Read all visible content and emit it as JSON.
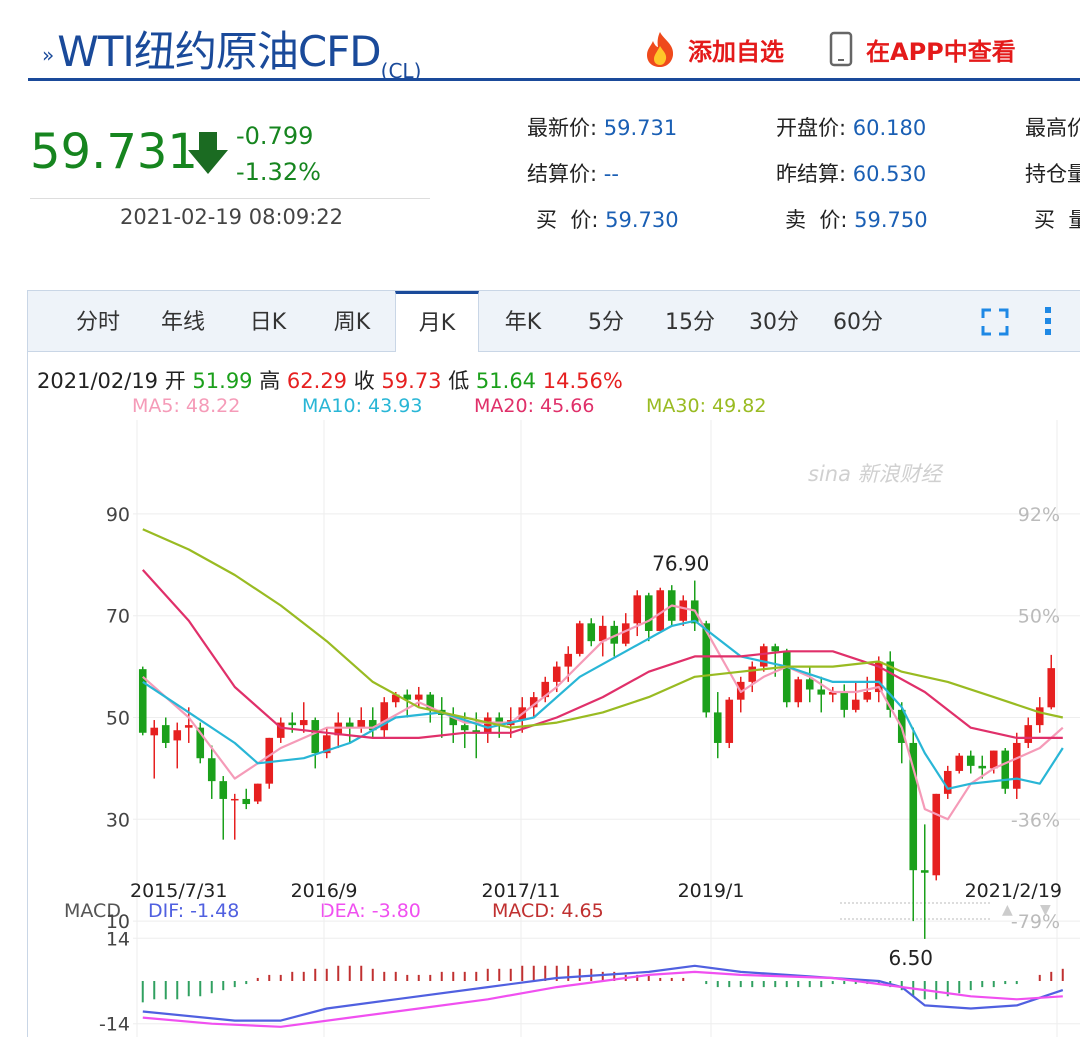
{
  "header": {
    "title": "WTI纽约原油CFD",
    "code": "(CL)",
    "add_favorite": "添加自选",
    "view_app": "在APP中查看"
  },
  "quote": {
    "price": "59.731",
    "change": "-0.799",
    "change_pct": "-1.32%",
    "time": "2021-02-19 08:09:22",
    "latest_label": "最新价:",
    "latest": "59.731",
    "open_label": "开盘价:",
    "open": "60.180",
    "high_label": "最高价",
    "settle_label": "结算价:",
    "settle": "--",
    "prev_settle_label": "昨结算:",
    "prev_settle": "60.530",
    "oi_label": "持仓量",
    "bid_label": "买  价:",
    "bid": "59.730",
    "ask_label": "卖  价:",
    "ask": "59.750",
    "bid_vol_label": "买  量"
  },
  "tabs": [
    "分时",
    "年线",
    "日K",
    "周K",
    "月K",
    "年K",
    "5分",
    "15分",
    "30分",
    "60分"
  ],
  "active_tab": "月K",
  "info": {
    "date": "2021/02/19",
    "open_label": "开",
    "open": "51.99",
    "high_label": "高",
    "high": "62.29",
    "close_label": "收",
    "close": "59.73",
    "low_label": "低",
    "low": "51.64",
    "pct": "14.56%",
    "ma5": "MA5: 48.22",
    "ma10": "MA10: 43.93",
    "ma20": "MA20: 45.66",
    "ma30": "MA30: 49.82"
  },
  "macd_info": {
    "label": "MACD",
    "dif": "DIF: -1.48",
    "dea": "DEA: -3.80",
    "macd": "MACD: 4.65"
  },
  "watermark": "sina 新浪财经",
  "colors": {
    "up": "#e62020",
    "down": "#1ba01b",
    "ma5": "#f59bb8",
    "ma10": "#29b6d6",
    "ma20": "#e0306a",
    "ma30": "#99bb22",
    "dif": "#5060e0",
    "dea": "#f050f0"
  },
  "chart_data": [
    {
      "type": "candlestick",
      "title": "",
      "ylim": [
        2,
        96
      ],
      "y_ticks": [
        90,
        70,
        50,
        30,
        10
      ],
      "pct_ticks": [
        "92%",
        "50%",
        "-36%",
        "-79%"
      ],
      "x_labels": [
        "2015/7/31",
        "2016/9",
        "2017/11",
        "2019/1",
        "2021/2/19"
      ],
      "annotations": [
        {
          "text": "76.90",
          "at": "high"
        },
        {
          "text": "6.50",
          "at": "low"
        }
      ],
      "candles": [
        [
          59.5,
          47,
          60,
          46.5
        ],
        [
          46.5,
          48,
          49.5,
          38
        ],
        [
          48.5,
          45,
          50,
          44
        ],
        [
          45.5,
          47.5,
          49,
          40
        ],
        [
          48,
          48.5,
          52,
          45
        ],
        [
          48,
          42,
          49,
          41
        ],
        [
          42,
          37.5,
          44.5,
          34
        ],
        [
          37.5,
          34,
          38.5,
          26
        ],
        [
          34,
          34,
          35,
          26
        ],
        [
          34,
          33,
          36,
          32
        ],
        [
          33.5,
          37,
          37,
          33
        ],
        [
          37,
          46,
          46,
          36
        ],
        [
          46,
          49,
          50,
          45
        ],
        [
          49,
          48.5,
          51,
          47
        ],
        [
          48.5,
          49.5,
          53,
          47
        ],
        [
          49.5,
          43,
          50,
          40
        ],
        [
          43,
          46.5,
          48,
          42
        ],
        [
          46.5,
          49,
          51,
          44
        ],
        [
          49,
          48,
          50,
          45
        ],
        [
          48,
          49.5,
          52,
          47
        ],
        [
          49.5,
          47.5,
          52,
          46
        ],
        [
          47.5,
          53,
          54,
          46
        ],
        [
          53,
          54.5,
          55,
          52
        ],
        [
          54.5,
          53.5,
          55.5,
          50
        ],
        [
          53.5,
          54.5,
          56,
          52
        ],
        [
          54.5,
          51.5,
          55,
          49
        ],
        [
          51.5,
          50.5,
          54,
          46
        ],
        [
          50.5,
          48.5,
          52,
          45
        ],
        [
          48.5,
          47.5,
          51,
          44
        ],
        [
          47.5,
          47,
          51,
          42
        ],
        [
          47,
          50,
          51,
          45
        ],
        [
          50,
          48.5,
          51,
          46
        ],
        [
          48.5,
          49.5,
          52,
          46
        ],
        [
          49.5,
          52,
          54,
          47
        ],
        [
          52,
          54,
          55,
          50
        ],
        [
          54,
          57,
          58,
          53
        ],
        [
          57,
          60,
          61,
          55
        ],
        [
          60,
          62.5,
          64,
          57
        ],
        [
          62.5,
          68.5,
          69,
          62
        ],
        [
          68.5,
          65,
          69.5,
          64
        ],
        [
          65,
          68,
          70,
          62
        ],
        [
          68,
          64.5,
          69,
          62
        ],
        [
          64.5,
          68.5,
          70.5,
          64
        ],
        [
          68.5,
          74,
          75,
          66
        ],
        [
          74,
          67,
          74.5,
          65
        ],
        [
          67,
          75,
          75.5,
          67
        ],
        [
          75,
          69,
          76,
          68
        ],
        [
          69,
          73,
          74,
          68
        ],
        [
          73,
          68.5,
          76.9,
          67
        ],
        [
          68.5,
          51,
          69,
          50
        ],
        [
          51,
          45,
          55,
          42
        ],
        [
          45,
          53.5,
          54,
          44
        ],
        [
          53.5,
          57,
          58,
          51
        ],
        [
          57,
          60,
          61,
          55
        ],
        [
          60,
          64,
          64.5,
          59
        ],
        [
          64,
          63,
          64.5,
          58
        ],
        [
          63,
          53,
          63.5,
          52
        ],
        [
          53,
          57.5,
          58,
          52
        ],
        [
          57.5,
          55.5,
          60,
          53
        ],
        [
          55.5,
          54.5,
          58,
          51
        ],
        [
          54.5,
          55,
          56,
          53
        ],
        [
          55,
          51.5,
          56.5,
          50
        ],
        [
          51.5,
          53.5,
          57,
          51
        ],
        [
          53.5,
          55,
          58,
          53
        ],
        [
          55,
          61,
          62,
          53
        ],
        [
          61,
          51.5,
          63,
          50
        ],
        [
          51.5,
          45,
          53,
          41
        ],
        [
          45,
          20,
          48,
          10
        ],
        [
          20,
          19.5,
          29,
          6.5
        ],
        [
          19,
          35,
          35,
          18
        ],
        [
          35,
          39.5,
          40.5,
          34
        ],
        [
          39.5,
          42.5,
          43,
          39
        ],
        [
          42.5,
          40.5,
          43.5,
          39
        ],
        [
          40.5,
          40,
          42.5,
          38
        ],
        [
          40,
          43.5,
          43.5,
          39
        ],
        [
          43.5,
          36,
          44,
          35
        ],
        [
          36,
          45,
          47,
          34
        ],
        [
          45,
          48.5,
          50,
          44
        ],
        [
          48.5,
          52,
          54,
          47
        ],
        [
          52,
          59.7,
          62.3,
          51.6
        ]
      ],
      "ma": {
        "MA5": [
          [
            0,
            58
          ],
          [
            4,
            50
          ],
          [
            8,
            38
          ],
          [
            12,
            44
          ],
          [
            16,
            48
          ],
          [
            20,
            48
          ],
          [
            24,
            53
          ],
          [
            28,
            49
          ],
          [
            32,
            49
          ],
          [
            36,
            56
          ],
          [
            40,
            65
          ],
          [
            44,
            69
          ],
          [
            46,
            72
          ],
          [
            48,
            71
          ],
          [
            50,
            63
          ],
          [
            52,
            55
          ],
          [
            54,
            58
          ],
          [
            56,
            60
          ],
          [
            58,
            58
          ],
          [
            60,
            55
          ],
          [
            62,
            55
          ],
          [
            64,
            56
          ],
          [
            66,
            48
          ],
          [
            68,
            32
          ],
          [
            70,
            30
          ],
          [
            72,
            37
          ],
          [
            74,
            40
          ],
          [
            76,
            42
          ],
          [
            78,
            44
          ],
          [
            80,
            48
          ]
        ],
        "MA10": [
          [
            0,
            57
          ],
          [
            4,
            51
          ],
          [
            8,
            45
          ],
          [
            10,
            41
          ],
          [
            14,
            42
          ],
          [
            18,
            45
          ],
          [
            22,
            50
          ],
          [
            26,
            51
          ],
          [
            30,
            48
          ],
          [
            34,
            50
          ],
          [
            38,
            58
          ],
          [
            42,
            63
          ],
          [
            46,
            68
          ],
          [
            48,
            69
          ],
          [
            52,
            62
          ],
          [
            56,
            60
          ],
          [
            60,
            57
          ],
          [
            64,
            57
          ],
          [
            66,
            52
          ],
          [
            68,
            43
          ],
          [
            70,
            36
          ],
          [
            72,
            37
          ],
          [
            76,
            38
          ],
          [
            78,
            37
          ],
          [
            80,
            44
          ]
        ],
        "MA20": [
          [
            0,
            79
          ],
          [
            4,
            69
          ],
          [
            8,
            56
          ],
          [
            12,
            48
          ],
          [
            16,
            47
          ],
          [
            20,
            46
          ],
          [
            24,
            46
          ],
          [
            28,
            47
          ],
          [
            32,
            47
          ],
          [
            36,
            50
          ],
          [
            40,
            54
          ],
          [
            44,
            59
          ],
          [
            48,
            62
          ],
          [
            52,
            62
          ],
          [
            56,
            63
          ],
          [
            60,
            63
          ],
          [
            64,
            60
          ],
          [
            68,
            55
          ],
          [
            72,
            48
          ],
          [
            76,
            46
          ],
          [
            80,
            46
          ]
        ],
        "MA30": [
          [
            0,
            87
          ],
          [
            4,
            83
          ],
          [
            8,
            78
          ],
          [
            12,
            72
          ],
          [
            16,
            65
          ],
          [
            20,
            57
          ],
          [
            24,
            52
          ],
          [
            28,
            50
          ],
          [
            32,
            48
          ],
          [
            36,
            49
          ],
          [
            40,
            51
          ],
          [
            44,
            54
          ],
          [
            48,
            58
          ],
          [
            52,
            59
          ],
          [
            56,
            60
          ],
          [
            60,
            60
          ],
          [
            64,
            61
          ],
          [
            66,
            59
          ],
          [
            70,
            57
          ],
          [
            74,
            54
          ],
          [
            78,
            51
          ],
          [
            80,
            50
          ]
        ]
      }
    },
    {
      "type": "macd",
      "title": "",
      "ylim": [
        -16,
        16
      ],
      "y_ticks": [
        14,
        -14
      ],
      "dif": [
        [
          0,
          -10
        ],
        [
          8,
          -13
        ],
        [
          12,
          -13
        ],
        [
          16,
          -9
        ],
        [
          22,
          -6
        ],
        [
          30,
          -2
        ],
        [
          36,
          1
        ],
        [
          44,
          3
        ],
        [
          48,
          5
        ],
        [
          52,
          3
        ],
        [
          56,
          2
        ],
        [
          60,
          1
        ],
        [
          64,
          0
        ],
        [
          66,
          -2
        ],
        [
          68,
          -8
        ],
        [
          72,
          -9
        ],
        [
          76,
          -8
        ],
        [
          80,
          -3
        ]
      ],
      "dea": [
        [
          0,
          -12
        ],
        [
          6,
          -14
        ],
        [
          12,
          -15
        ],
        [
          18,
          -12
        ],
        [
          24,
          -9
        ],
        [
          30,
          -6
        ],
        [
          36,
          -2
        ],
        [
          44,
          2
        ],
        [
          48,
          3
        ],
        [
          52,
          2
        ],
        [
          60,
          1
        ],
        [
          64,
          -1
        ],
        [
          68,
          -3
        ],
        [
          72,
          -5
        ],
        [
          76,
          -6
        ],
        [
          80,
          -5
        ]
      ],
      "hist": [
        -7,
        -6,
        -6,
        -6,
        -5,
        -5,
        -4,
        -3,
        -2,
        -1,
        1,
        2,
        2,
        3,
        3,
        4,
        4,
        5,
        5,
        5,
        4,
        3,
        3,
        2,
        2,
        2,
        3,
        3,
        3,
        3,
        4,
        4,
        4,
        5,
        5,
        5,
        5,
        5,
        4,
        4,
        3,
        3,
        2,
        2,
        2,
        1,
        1,
        1,
        0,
        -1,
        -2,
        -2,
        -2,
        -2,
        -2,
        -2,
        -2,
        -2,
        -2,
        -2,
        -1,
        -1,
        -1,
        -1,
        -1,
        -2,
        -3,
        -5,
        -6,
        -6,
        -5,
        -4,
        -3,
        -2,
        -2,
        -1,
        -1,
        0,
        2,
        3,
        4
      ]
    }
  ]
}
